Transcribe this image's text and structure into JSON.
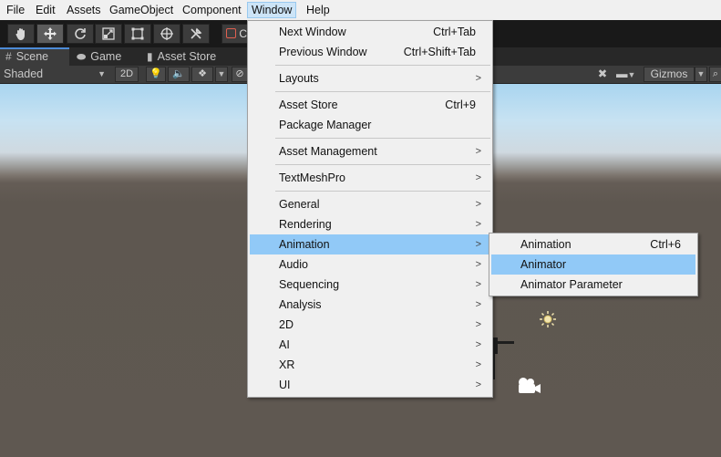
{
  "menubar": {
    "items": [
      "File",
      "Edit",
      "Assets",
      "GameObject",
      "Component",
      "Window",
      "Help"
    ]
  },
  "toolbar": {
    "tools": [
      "hand-tool-icon",
      "move-tool-icon",
      "rotate-tool-icon",
      "scale-tool-icon",
      "rect-tool-icon",
      "transform-tool-icon",
      "custom-tool-icon"
    ],
    "partial_label": "C"
  },
  "tabs": [
    {
      "label": "Scene",
      "icon": "grid-icon"
    },
    {
      "label": "Game",
      "icon": "gamepad-icon"
    },
    {
      "label": "Asset Store",
      "icon": "store-bag-icon"
    }
  ],
  "scene_toolbar": {
    "shading_mode": "Shaded",
    "mode_2d": "2D",
    "gizmos": "Gizmos"
  },
  "window_menu": [
    {
      "label": "Next Window",
      "shortcut": "Ctrl+Tab"
    },
    {
      "label": "Previous Window",
      "shortcut": "Ctrl+Shift+Tab"
    },
    {
      "label": "Layouts",
      "submenu": true
    },
    {
      "label": "Asset Store",
      "shortcut": "Ctrl+9"
    },
    {
      "label": "Package Manager"
    },
    {
      "label": "Asset Management",
      "submenu": true
    },
    {
      "label": "TextMeshPro",
      "submenu": true
    },
    {
      "label": "General",
      "submenu": true
    },
    {
      "label": "Rendering",
      "submenu": true
    },
    {
      "label": "Animation",
      "submenu": true,
      "highlighted": true
    },
    {
      "label": "Audio",
      "submenu": true
    },
    {
      "label": "Sequencing",
      "submenu": true
    },
    {
      "label": "Analysis",
      "submenu": true
    },
    {
      "label": "2D",
      "submenu": true
    },
    {
      "label": "AI",
      "submenu": true
    },
    {
      "label": "XR",
      "submenu": true
    },
    {
      "label": "UI",
      "submenu": true
    }
  ],
  "animation_submenu": [
    {
      "label": "Animation",
      "shortcut": "Ctrl+6"
    },
    {
      "label": "Animator",
      "highlighted": true
    },
    {
      "label": "Animator Parameter"
    }
  ],
  "colors": {
    "menu_highlight": "#91c9f7",
    "active_menubar_item": "#cce4f7",
    "tab_accent": "#4d8bd6"
  }
}
